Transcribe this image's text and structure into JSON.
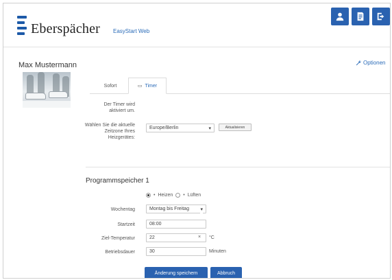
{
  "header": {
    "brand": "Eberspächer",
    "subbrand": "EasyStart Web",
    "icons": [
      "user-icon",
      "document-icon",
      "logout-icon"
    ]
  },
  "user": {
    "name": "Max Mustermann",
    "options_label": "Optionen"
  },
  "tabs": [
    {
      "label": "Sofort",
      "active": false
    },
    {
      "label": "Timer",
      "active": true
    }
  ],
  "timer": {
    "status_label": "Der Timer wird aktiviert um.",
    "timezone_label": "Wählen Sie die aktuelle Zeitzone Ihres Heizgerätes:",
    "timezone_value": "Europe/Berlin",
    "refresh_label": "Aktualisieren"
  },
  "program": {
    "title": "Programmspeicher 1",
    "mode_heat": "Heizen",
    "mode_vent": "Lüften",
    "weekday_label": "Wochentag",
    "weekday_value": "Montag bis Freitag",
    "start_label": "Startzeit",
    "start_value": "08:00",
    "temp_label": "Ziel-Temperatur",
    "temp_value": "22",
    "temp_unit": "°C",
    "duration_label": "Betriebsdauer",
    "duration_value": "30",
    "duration_unit": "Minuten"
  },
  "actions": {
    "save_label": "Änderung speichern",
    "cancel_label": "Abbruch"
  },
  "colors": {
    "accent": "#2a62b0",
    "link": "#2a6bb8",
    "logo": "#1d5aa8"
  }
}
